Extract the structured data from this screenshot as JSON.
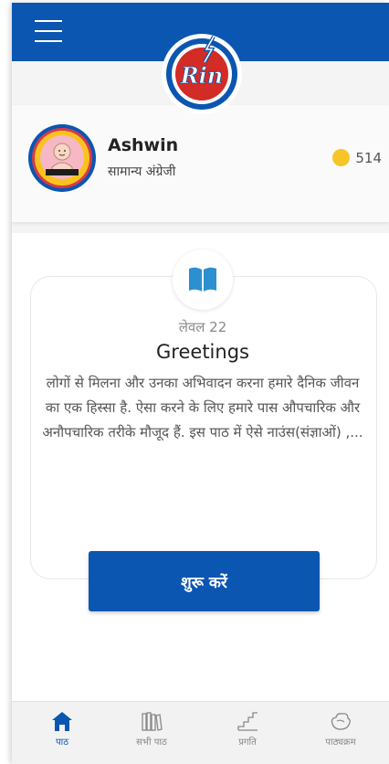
{
  "colors": {
    "brand": "#0a56b1",
    "coin": "#f6c528",
    "logo_red": "#d32b25"
  },
  "logo": {
    "text": "Rin"
  },
  "profile": {
    "name": "Ashwin",
    "course": "सामान्य अंग्रेजी",
    "coins": "514"
  },
  "lesson": {
    "level": "लेवल 22",
    "title": "Greetings",
    "description": "लोगों से मिलना और उनका अभिवादन करना हमारे दैनिक जीवन का एक हिस्सा है. ऐसा करने के लिए हमारे पास औपचारिक और अनौपचारिक तरीके मौजूद हैं. इस पाठ में ऐसे नाउंस(संज्ञाओं) ,...",
    "start_label": "शुरू करें"
  },
  "nav": [
    {
      "label": "पाठ",
      "icon": "home-icon",
      "active": true
    },
    {
      "label": "सभी पाठ",
      "icon": "books-icon"
    },
    {
      "label": "प्रगति",
      "icon": "stairs-icon"
    },
    {
      "label": "पाठ्यक्रम",
      "icon": "globe-icon"
    }
  ]
}
